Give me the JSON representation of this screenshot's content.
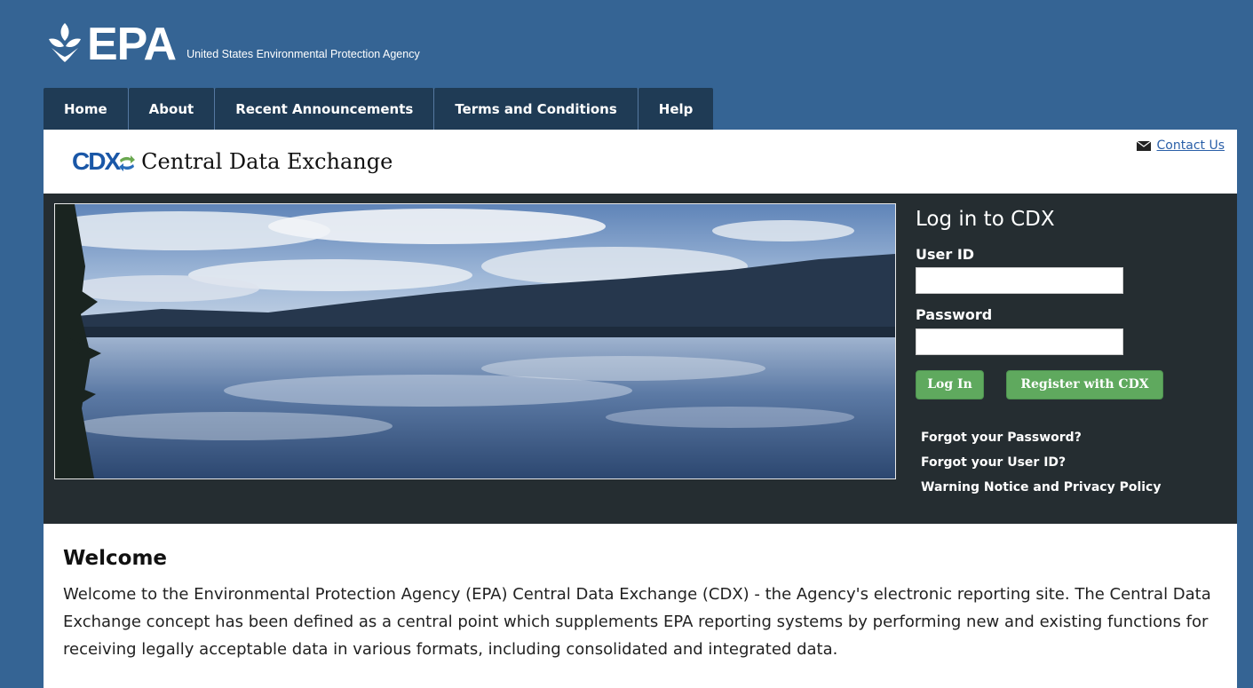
{
  "header": {
    "logo_text": "EPA",
    "agency_name": "United States Environmental Protection Agency"
  },
  "nav": {
    "tabs": [
      {
        "label": "Home"
      },
      {
        "label": "About"
      },
      {
        "label": "Recent Announcements"
      },
      {
        "label": "Terms and Conditions"
      },
      {
        "label": "Help"
      }
    ]
  },
  "cdx": {
    "logo_text": "CDX",
    "title": "Central Data Exchange",
    "contact_label": "Contact Us"
  },
  "login": {
    "title": "Log in to CDX",
    "user_id_label": "User ID",
    "user_id_value": "",
    "password_label": "Password",
    "password_value": "",
    "login_button": "Log In",
    "register_button": "Register with CDX",
    "links": [
      {
        "label": "Forgot your Password?"
      },
      {
        "label": "Forgot your User ID?"
      },
      {
        "label": "Warning Notice and Privacy Policy"
      }
    ]
  },
  "welcome": {
    "heading": "Welcome",
    "body": "Welcome to the Environmental Protection Agency (EPA) Central Data Exchange (CDX) - the Agency's electronic reporting site. The Central Data Exchange concept has been defined as a central point which supplements EPA reporting systems by performing new and existing functions for receiving legally acceptable data in various formats, including consolidated and integrated data."
  },
  "colors": {
    "page_background": "#356494",
    "nav_tab": "#1f3b55",
    "hero_panel": "#252d31",
    "button_green": "#5fa95e",
    "link_blue": "#2a5fa8"
  },
  "icons": {
    "epa_logo": "epa-flower-logo",
    "contact": "envelope-icon",
    "cdx": "cdx-arrows-logo"
  }
}
